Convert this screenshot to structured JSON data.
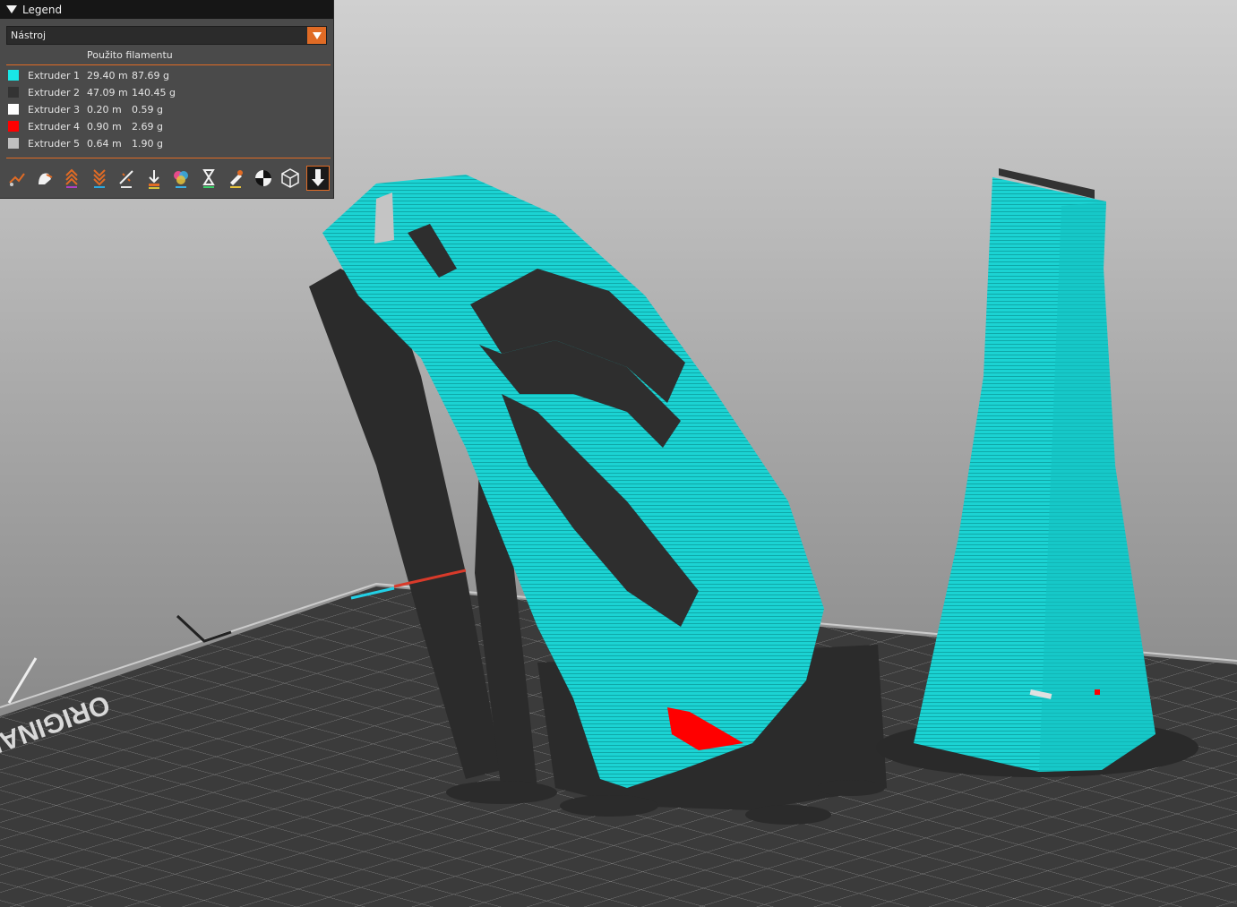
{
  "legend": {
    "title": "Legend",
    "view_type_selected": "Nástroj",
    "column_header": "Použito filamentu",
    "rows": [
      {
        "name": "Extruder 1",
        "length": "29.40 m",
        "weight": "87.69 g",
        "color": "#19e6e6"
      },
      {
        "name": "Extruder 2",
        "length": "47.09 m",
        "weight": "140.45 g",
        "color": "#333333"
      },
      {
        "name": "Extruder 3",
        "length": "0.20 m",
        "weight": "0.59 g",
        "color": "#ffffff"
      },
      {
        "name": "Extruder 4",
        "length": "0.90 m",
        "weight": "2.69 g",
        "color": "#ff0000"
      },
      {
        "name": "Extruder 5",
        "length": "0.64 m",
        "weight": "1.90 g",
        "color": "#c0c0c0"
      }
    ],
    "toolbar": [
      {
        "icon": "travel-icon"
      },
      {
        "icon": "wipe-icon"
      },
      {
        "icon": "retractions-icon"
      },
      {
        "icon": "deretractions-icon"
      },
      {
        "icon": "seams-icon"
      },
      {
        "icon": "tool-changes-icon"
      },
      {
        "icon": "color-changes-icon"
      },
      {
        "icon": "pause-prints-icon"
      },
      {
        "icon": "custom-gcodes-icon"
      },
      {
        "icon": "center-of-gravity-icon"
      },
      {
        "icon": "shells-icon"
      },
      {
        "icon": "tool-marker-icon"
      }
    ]
  },
  "bed": {
    "label": "ORIGINAL"
  },
  "colors": {
    "accent": "#e06b25",
    "background": "#9a9a9a"
  }
}
